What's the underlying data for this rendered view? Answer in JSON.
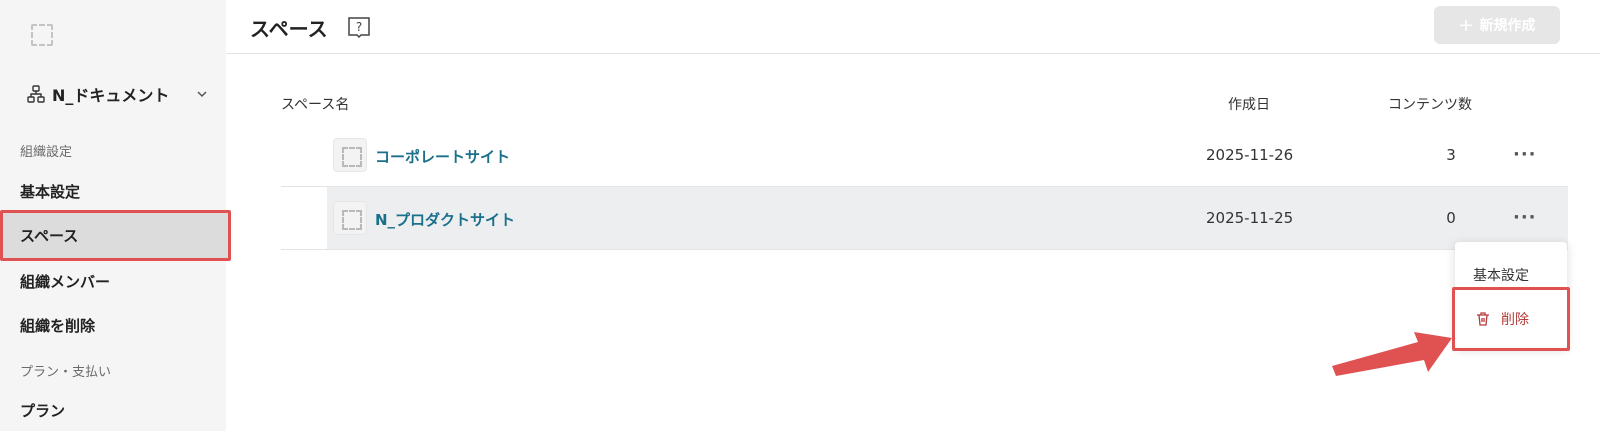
{
  "sidebar": {
    "org_name": "N_ドキュメント",
    "section_org": "組織設定",
    "section_plan": "プラン・支払い",
    "items": [
      {
        "label": "基本設定"
      },
      {
        "label": "スペース"
      },
      {
        "label": "組織メンバー"
      },
      {
        "label": "組織を削除"
      },
      {
        "label": "プラン"
      }
    ]
  },
  "header": {
    "title": "スペース",
    "new_button": "新規作成"
  },
  "table": {
    "columns": {
      "name": "スペース名",
      "created": "作成日",
      "contents": "コンテンツ数"
    },
    "rows": [
      {
        "name": "コーポレートサイト",
        "created": "2025-11-26",
        "contents": "3"
      },
      {
        "name": "N_プロダクトサイト",
        "created": "2025-11-25",
        "contents": "0"
      }
    ],
    "more_label": "···"
  },
  "menu": {
    "settings": "基本設定",
    "delete": "削除"
  },
  "colors": {
    "accent_link": "#1a6f8a",
    "highlight": "#e05252",
    "danger_text": "#b33b3b"
  },
  "icons": [
    "logo-placeholder-icon",
    "org-tree-icon",
    "chevron-down-icon",
    "help-book-icon",
    "plus-icon",
    "space-thumbnail-icon",
    "more-icon",
    "trash-icon",
    "arrow-annotation-icon"
  ]
}
